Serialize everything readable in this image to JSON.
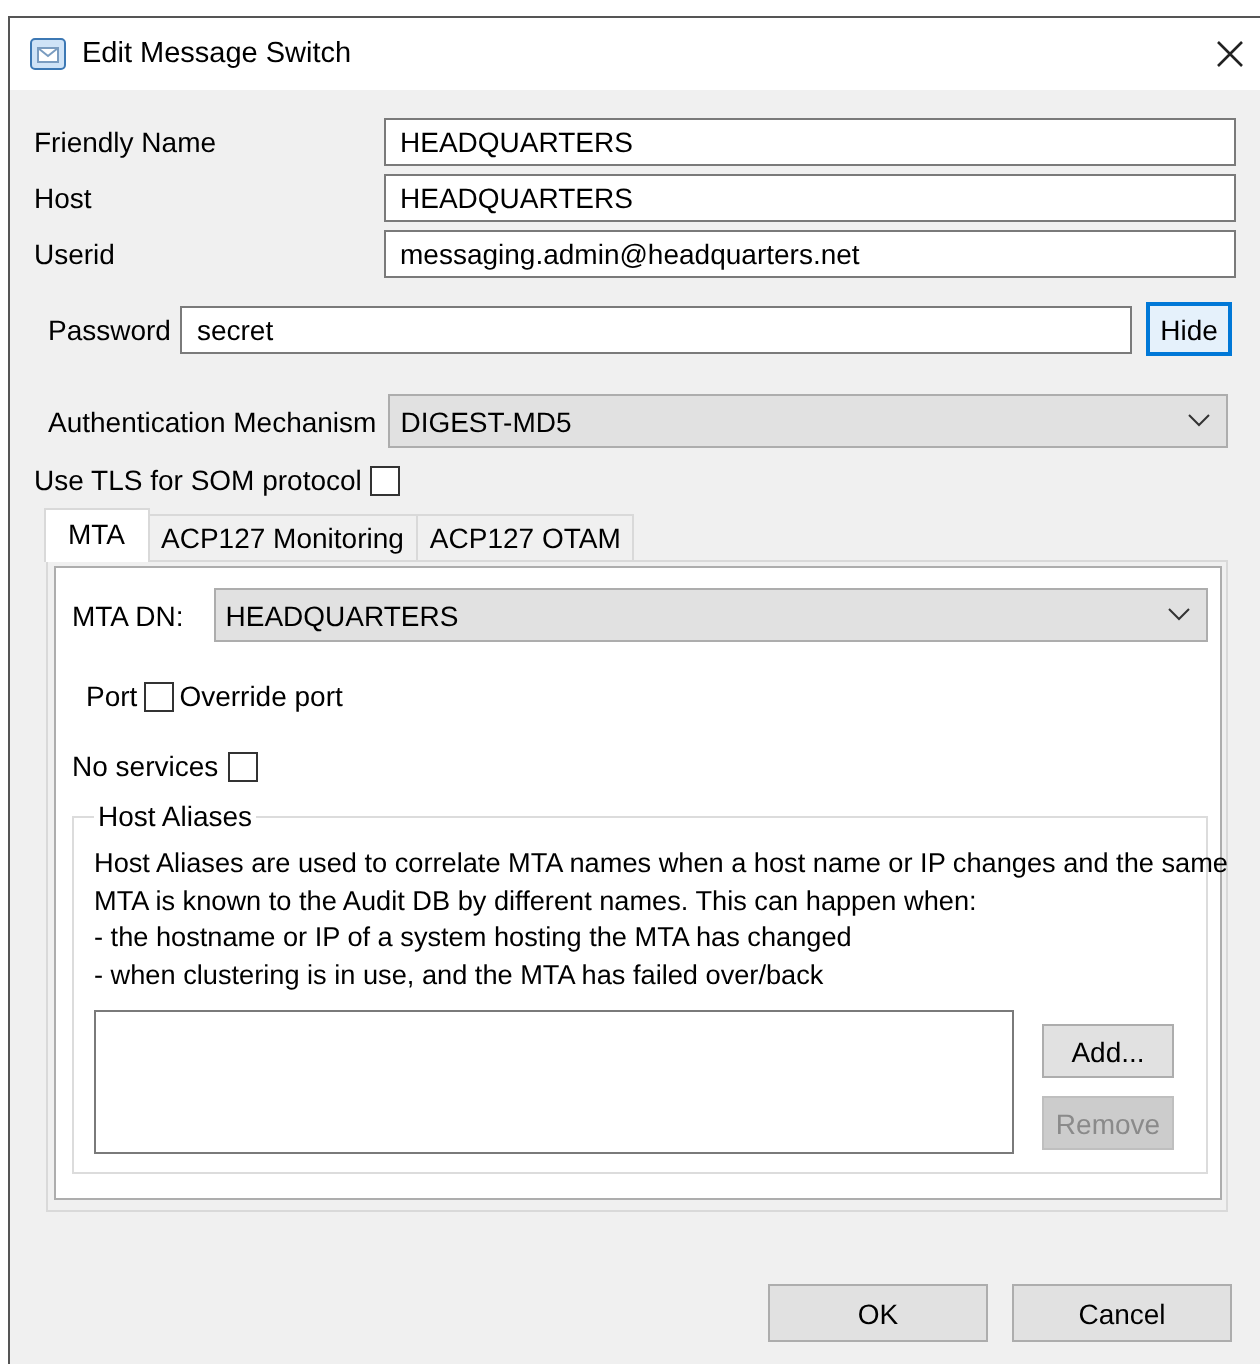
{
  "window": {
    "title": "Edit Message Switch"
  },
  "fields": [
    {
      "label": "Friendly Name",
      "value": "HEADQUARTERS"
    },
    {
      "label": "Host",
      "value": "HEADQUARTERS"
    },
    {
      "label": "Userid",
      "value": "messaging.admin@headquarters.net"
    }
  ],
  "password": {
    "label": "Password",
    "value": "secret",
    "button": "Hide",
    "button_focused": true
  },
  "auth": {
    "label": "Authentication Mechanism",
    "value": "DIGEST-MD5"
  },
  "tls": {
    "label": "Use TLS for SOM protocol",
    "checked": false
  },
  "tabs": [
    {
      "label": "MTA",
      "selected": true
    },
    {
      "label": "ACP127 Monitoring",
      "selected": false
    },
    {
      "label": "ACP127 OTAM",
      "selected": false
    }
  ],
  "mta": {
    "dn_label": "MTA DN:",
    "dn_value": "HEADQUARTERS",
    "port_label": "Port",
    "override": {
      "label": "Override port",
      "checked": false
    },
    "no_services": {
      "label": "No services",
      "checked": false
    }
  },
  "host_aliases": {
    "title": "Host Aliases",
    "description": "Host Aliases are used to correlate MTA names when a host name or IP changes and the same MTA is known to the Audit DB by different names. This can happen when:",
    "bullets": [
      "- the hostname or IP of a system hosting the MTA has changed",
      "- when clustering is in use, and the MTA has failed over/back"
    ],
    "buttons": [
      {
        "label": "Add...",
        "disabled": false
      },
      {
        "label": "Remove",
        "disabled": true
      }
    ]
  },
  "buttons": [
    "OK",
    "Cancel"
  ]
}
